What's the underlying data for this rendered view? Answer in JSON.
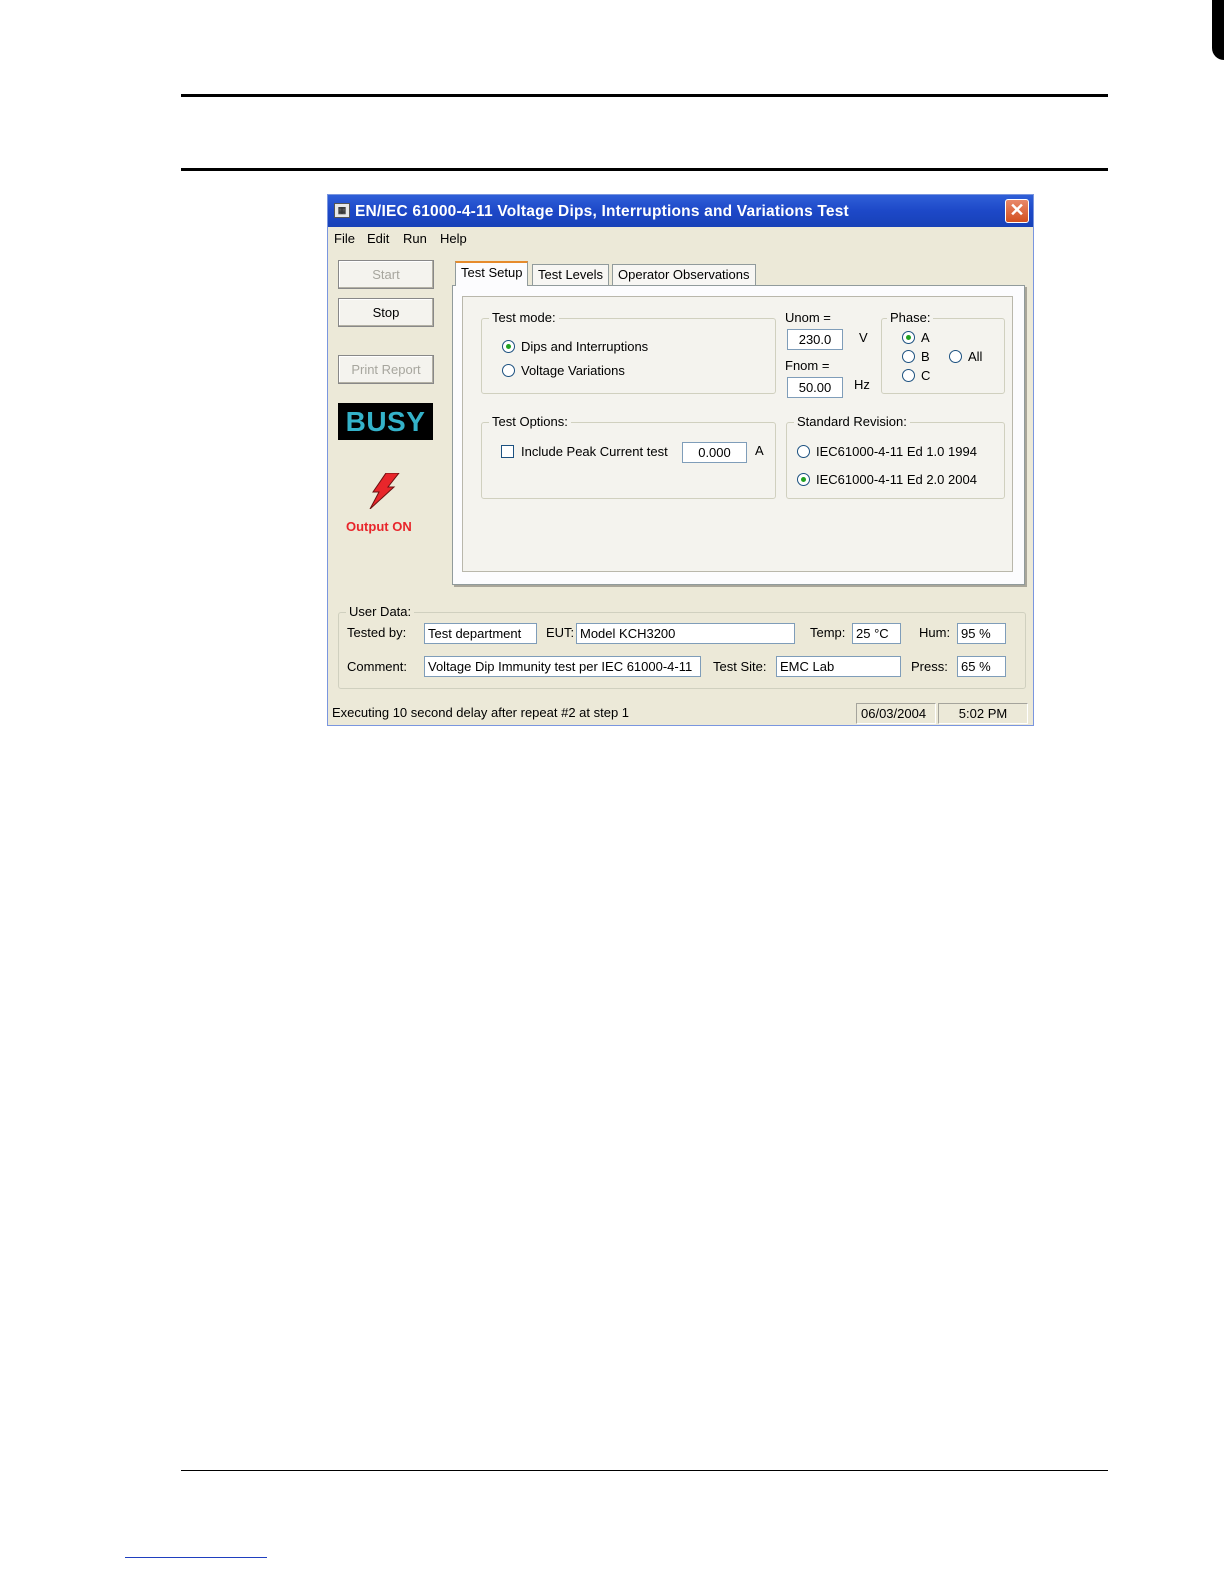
{
  "window": {
    "title": "EN/IEC 61000-4-11 Voltage Dips, Interruptions and Variations Test",
    "close_symbol": "✕",
    "app_icon_glyph": "▦"
  },
  "menu": [
    "File",
    "Edit",
    "Run",
    "Help"
  ],
  "buttons": {
    "start": "Start",
    "stop": "Stop",
    "print_report": "Print Report"
  },
  "status_indicator": "BUSY",
  "output_state": "Output ON",
  "tabs": [
    "Test Setup",
    "Test Levels",
    "Operator Observations"
  ],
  "test_mode": {
    "label": "Test mode:",
    "options": [
      "Dips and Interruptions",
      "Voltage Variations"
    ],
    "selected": "Dips and Interruptions"
  },
  "unom": {
    "label": "Unom =",
    "value": "230.0",
    "unit": "V"
  },
  "fnom": {
    "label": "Fnom =",
    "value": "50.00",
    "unit": "Hz"
  },
  "phase": {
    "label": "Phase:",
    "options": [
      "A",
      "B",
      "C",
      "All"
    ],
    "selected": "A"
  },
  "test_options": {
    "label": "Test Options:",
    "peak_current_label": "Include Peak Current test",
    "peak_current_checked": false,
    "peak_current_value": "0.000",
    "peak_current_unit": "A"
  },
  "standard_revision": {
    "label": "Standard Revision:",
    "options": [
      "IEC61000-4-11 Ed 1.0 1994",
      "IEC61000-4-11 Ed 2.0 2004"
    ],
    "selected": "IEC61000-4-11 Ed 2.0 2004"
  },
  "user_data": {
    "label": "User Data:",
    "tested_by_label": "Tested by:",
    "tested_by": "Test department",
    "eut_label": "EUT:",
    "eut": "Model KCH3200",
    "temp_label": "Temp:",
    "temp": "25 °C",
    "hum_label": "Hum:",
    "hum": "95 %",
    "comment_label": "Comment:",
    "comment": "Voltage Dip Immunity test per IEC 61000-4-11",
    "test_site_label": "Test Site:",
    "test_site": "EMC Lab",
    "press_label": "Press:",
    "press": "65 %"
  },
  "status_bar": {
    "message": "Executing 10 second delay after repeat #2 at step 1",
    "date": "06/03/2004",
    "time": "5:02 PM"
  },
  "colors": {
    "titlebar": "#1d48c8",
    "busy_text": "#34b2c9",
    "output_on": "#e8262b",
    "window_bg": "#ece9d8"
  }
}
